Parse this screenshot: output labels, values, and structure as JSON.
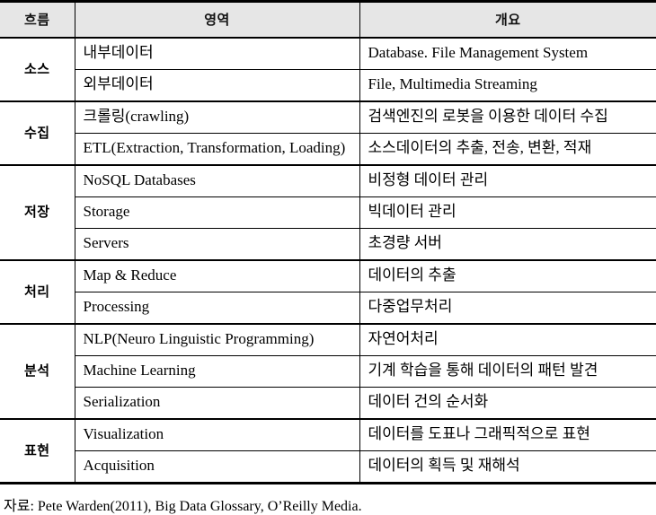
{
  "table": {
    "headers": {
      "flow": "흐름",
      "area": "영역",
      "overview": "개요"
    },
    "groups": [
      {
        "flow": "소스",
        "rows": [
          {
            "area": "내부데이터",
            "desc": "Database. File Management System"
          },
          {
            "area": "외부데이터",
            "desc": "File,  Multimedia  Streaming"
          }
        ]
      },
      {
        "flow": "수집",
        "rows": [
          {
            "area": "크롤링(crawling)",
            "desc": "검색엔진의 로봇을 이용한 데이터 수집"
          },
          {
            "area": "ETL(Extraction,  Transformation,  Loading)",
            "desc": "소스데이터의 추출, 전송, 변환, 적재"
          }
        ]
      },
      {
        "flow": "저장",
        "rows": [
          {
            "area": "NoSQL Databases",
            "desc": "비정형 데이터 관리"
          },
          {
            "area": "Storage",
            "desc": "빅데이터 관리"
          },
          {
            "area": "Servers",
            "desc": "초경량 서버"
          }
        ]
      },
      {
        "flow": "처리",
        "rows": [
          {
            "area": "Map  &  Reduce",
            "desc": "데이터의 추출"
          },
          {
            "area": "Processing",
            "desc": "다중업무처리"
          }
        ]
      },
      {
        "flow": "분석",
        "rows": [
          {
            "area": "NLP(Neuro Linguistic Programming)",
            "desc": "자연어처리"
          },
          {
            "area": "Machine  Learning",
            "desc": "기계 학습을 통해 데이터의 패턴 발견"
          },
          {
            "area": "Serialization",
            "desc": "데이터 건의 순서화"
          }
        ]
      },
      {
        "flow": "표현",
        "rows": [
          {
            "area": "Visualization",
            "desc": "데이터를 도표나 그래픽적으로 표현"
          },
          {
            "area": "Acquisition",
            "desc": "데이터의 획득 및 재해석"
          }
        ]
      }
    ]
  },
  "source_note": "자료: Pete Warden(2011), Big Data Glossary, O’Reilly Media."
}
